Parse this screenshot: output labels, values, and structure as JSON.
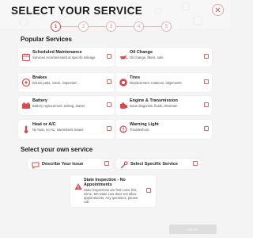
{
  "modal": {
    "title": "SELECT YOUR SERVICE",
    "close_icon": "close-icon"
  },
  "stepper": {
    "steps": [
      "1",
      "2",
      "3",
      "4",
      "5"
    ],
    "active_step": 1
  },
  "popular": {
    "heading": "Popular Services",
    "items": [
      {
        "name": "Scheduled Maintenance",
        "desc": "Services recommended at specific mileage",
        "icon": "calendar-icon"
      },
      {
        "name": "Oil Change",
        "desc": "Oil change, filters, lube",
        "icon": "oil-can-icon"
      },
      {
        "name": "Brakes",
        "desc": "Issues pads, rotors, inspection",
        "icon": "brake-icon"
      },
      {
        "name": "Tires",
        "desc": "Replacement, rotations, alignments",
        "icon": "tire-icon"
      },
      {
        "name": "Battery",
        "desc": "Battery replacement, testing, starter",
        "icon": "battery-icon"
      },
      {
        "name": "Engine & Transmission",
        "desc": "Issue diagnosis, fluids, drivetrain",
        "icon": "engine-icon"
      },
      {
        "name": "Heat or A/C",
        "desc": "No heat, no AC, intermittent issues",
        "icon": "thermometer-icon"
      },
      {
        "name": "Warning Light",
        "desc": "Troubleshoot",
        "icon": "warning-light-icon"
      }
    ]
  },
  "own": {
    "heading": "Select your own service",
    "items": [
      {
        "name": "Describe Your Issue",
        "icon": "chat-bubble-icon"
      },
      {
        "name": "Select Specific Service",
        "icon": "wrench-icon"
      }
    ]
  },
  "inspection": {
    "name": "State Inspection - No Appointments",
    "desc": "State Inspections are first come first serve, MA State Law does not allow appointments. Any questions, please call.",
    "icon": "warning-triangle-icon"
  },
  "footer": {
    "next_label": "NEXT"
  },
  "colors": {
    "accent": "#d94a4a",
    "background": "#f4f4f4",
    "card": "#ffffff",
    "disabled_button": "#dedede"
  }
}
